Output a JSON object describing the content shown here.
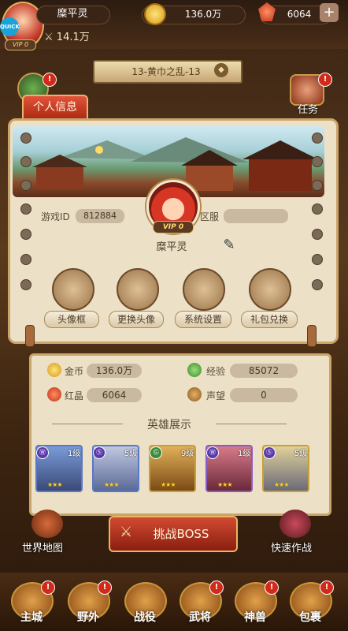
{
  "top_bar": {
    "quick_badge": "QUICK",
    "vip": "VIP 0",
    "player_name": "糜平灵",
    "gold": "136.0万",
    "ruby": "6064",
    "add": "+",
    "power": "14.1万"
  },
  "stage": {
    "name": "13-黄巾之乱-13"
  },
  "side": {
    "task_label": "任务",
    "badge": "!"
  },
  "panel": {
    "tab_title": "个人信息",
    "vip": "VIP 0",
    "game_id_label": "游戏ID",
    "game_id": "812884",
    "server_label": "区服",
    "server_value": "",
    "player_name": "糜平灵",
    "functions": [
      {
        "label": "头像框",
        "icon": "scroll-frame-icon"
      },
      {
        "label": "更换头像",
        "icon": "hero-portrait-icon"
      },
      {
        "label": "系统设置",
        "icon": "wrench-icon"
      },
      {
        "label": "礼包兑换",
        "icon": "gift-bag-icon"
      }
    ]
  },
  "stats": {
    "gold_label": "金币",
    "gold": "136.0万",
    "exp_label": "经验",
    "exp": "85072",
    "ruby_label": "红晶",
    "ruby": "6064",
    "fame_label": "声望",
    "fame": "0"
  },
  "heroes": {
    "title": "英雄展示",
    "cards": [
      {
        "level": "1级",
        "stars": 3,
        "frame": "#5a78c8"
      },
      {
        "level": "5级",
        "stars": 3,
        "frame": "#5a78c8"
      },
      {
        "level": "9级",
        "stars": 3,
        "frame": "#c8a038"
      },
      {
        "level": "1级",
        "stars": 3,
        "frame": "#8a5ac8"
      },
      {
        "level": "5级",
        "stars": 3,
        "frame": "#c8a038"
      }
    ]
  },
  "bottom": {
    "boss": "挑战BOSS",
    "world_map": "世界地图",
    "quick_battle": "快速作战"
  },
  "nav": [
    "主城",
    "野外",
    "战役",
    "武将",
    "神兽",
    "包裹"
  ]
}
